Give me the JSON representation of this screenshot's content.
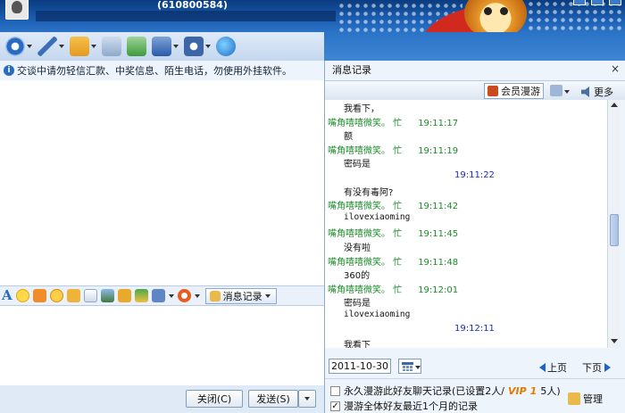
{
  "window": {
    "qq_number": "(610800584)"
  },
  "toolbar": {
    "buttons": [
      "video-icon",
      "voice-icon",
      "file-transfer-icon",
      "email-icon",
      "add-contact-icon",
      "apps-icon",
      "settings-icon",
      "browser-icon"
    ]
  },
  "chat": {
    "notice": "交谈中请勿轻信汇款、中奖信息、陌生电话，勿使用外挂软件。"
  },
  "format_bar": {
    "font_button": "A",
    "message_record_label": "消息记录"
  },
  "buttons": {
    "close_label": "关闭(C)",
    "send_label": "发送(S)"
  },
  "history_panel": {
    "title": "消息记录",
    "close_glyph": "×",
    "vip_roaming_label": "会员漫游",
    "more_label": "更多",
    "messages": [
      {
        "kind": "text",
        "text": "我看下，"
      },
      {
        "kind": "meta",
        "sender": "嘴角嘻嘻微笑。 忙",
        "time": "19:11:17"
      },
      {
        "kind": "text",
        "text": "额"
      },
      {
        "kind": "meta",
        "sender": "嘴角嘻嘻微笑。 忙",
        "time": "19:11:19"
      },
      {
        "kind": "text",
        "text": "密码是"
      },
      {
        "kind": "self",
        "time": "19:11:22"
      },
      {
        "kind": "text",
        "text": "有没有毒阿?"
      },
      {
        "kind": "meta",
        "sender": "嘴角嘻嘻微笑。 忙",
        "time": "19:11:42"
      },
      {
        "kind": "mono",
        "text": "ilovexiaoming"
      },
      {
        "kind": "meta",
        "sender": "嘴角嘻嘻微笑。 忙",
        "time": "19:11:45"
      },
      {
        "kind": "text",
        "text": "没有啦"
      },
      {
        "kind": "meta",
        "sender": "嘴角嘻嘻微笑。 忙",
        "time": "19:11:48"
      },
      {
        "kind": "text",
        "text": "360的"
      },
      {
        "kind": "meta",
        "sender": "嘴角嘻嘻微笑。 忙",
        "time": "19:12:01"
      },
      {
        "kind": "text",
        "text": "密码是"
      },
      {
        "kind": "mono",
        "text": "ilovexiaoming"
      },
      {
        "kind": "self",
        "time": "19:12:11"
      },
      {
        "kind": "text",
        "text": "我看下"
      }
    ],
    "date": "2011-10-30",
    "prev_page": "上页",
    "next_page": "下页",
    "option1_text": "永久漫游此好友聊天记录(已设置2人/",
    "option1_vip": "VIP",
    "option1_vip_count": "1",
    "option1_suffix": "5人)",
    "option2_text": "漫游全体好友最近1个月的记录",
    "option2_checked": true,
    "manage_label": "管理"
  },
  "colors": {
    "sender": "#1c8a2a",
    "self_time": "#1a2fb0",
    "header": "#1b5fb3"
  }
}
